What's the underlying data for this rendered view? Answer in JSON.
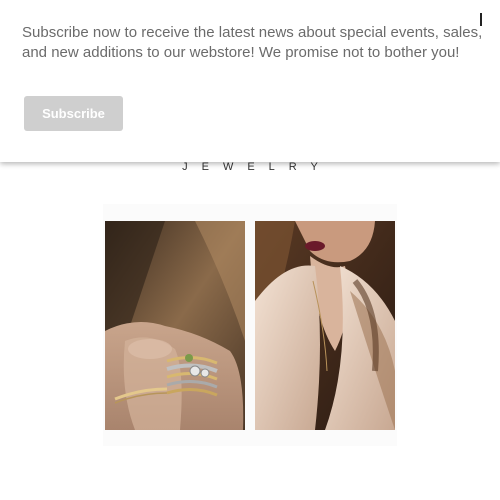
{
  "popup": {
    "message": "Subscribe now to receive the latest news about special events, sales, and new additions to our webstore! We promise not to bother you!",
    "subscribe_label": "Subscribe",
    "close_label": "I"
  },
  "brand": {
    "subtitle": "JEWELRY"
  },
  "images": {
    "left": "hand-with-stacked-rings-photo",
    "right": "woman-in-blouse-with-necklace-photo"
  },
  "colors": {
    "button_bg": "#cfcfcf",
    "message_text": "#6b6b6b",
    "background": "#ffffff"
  }
}
